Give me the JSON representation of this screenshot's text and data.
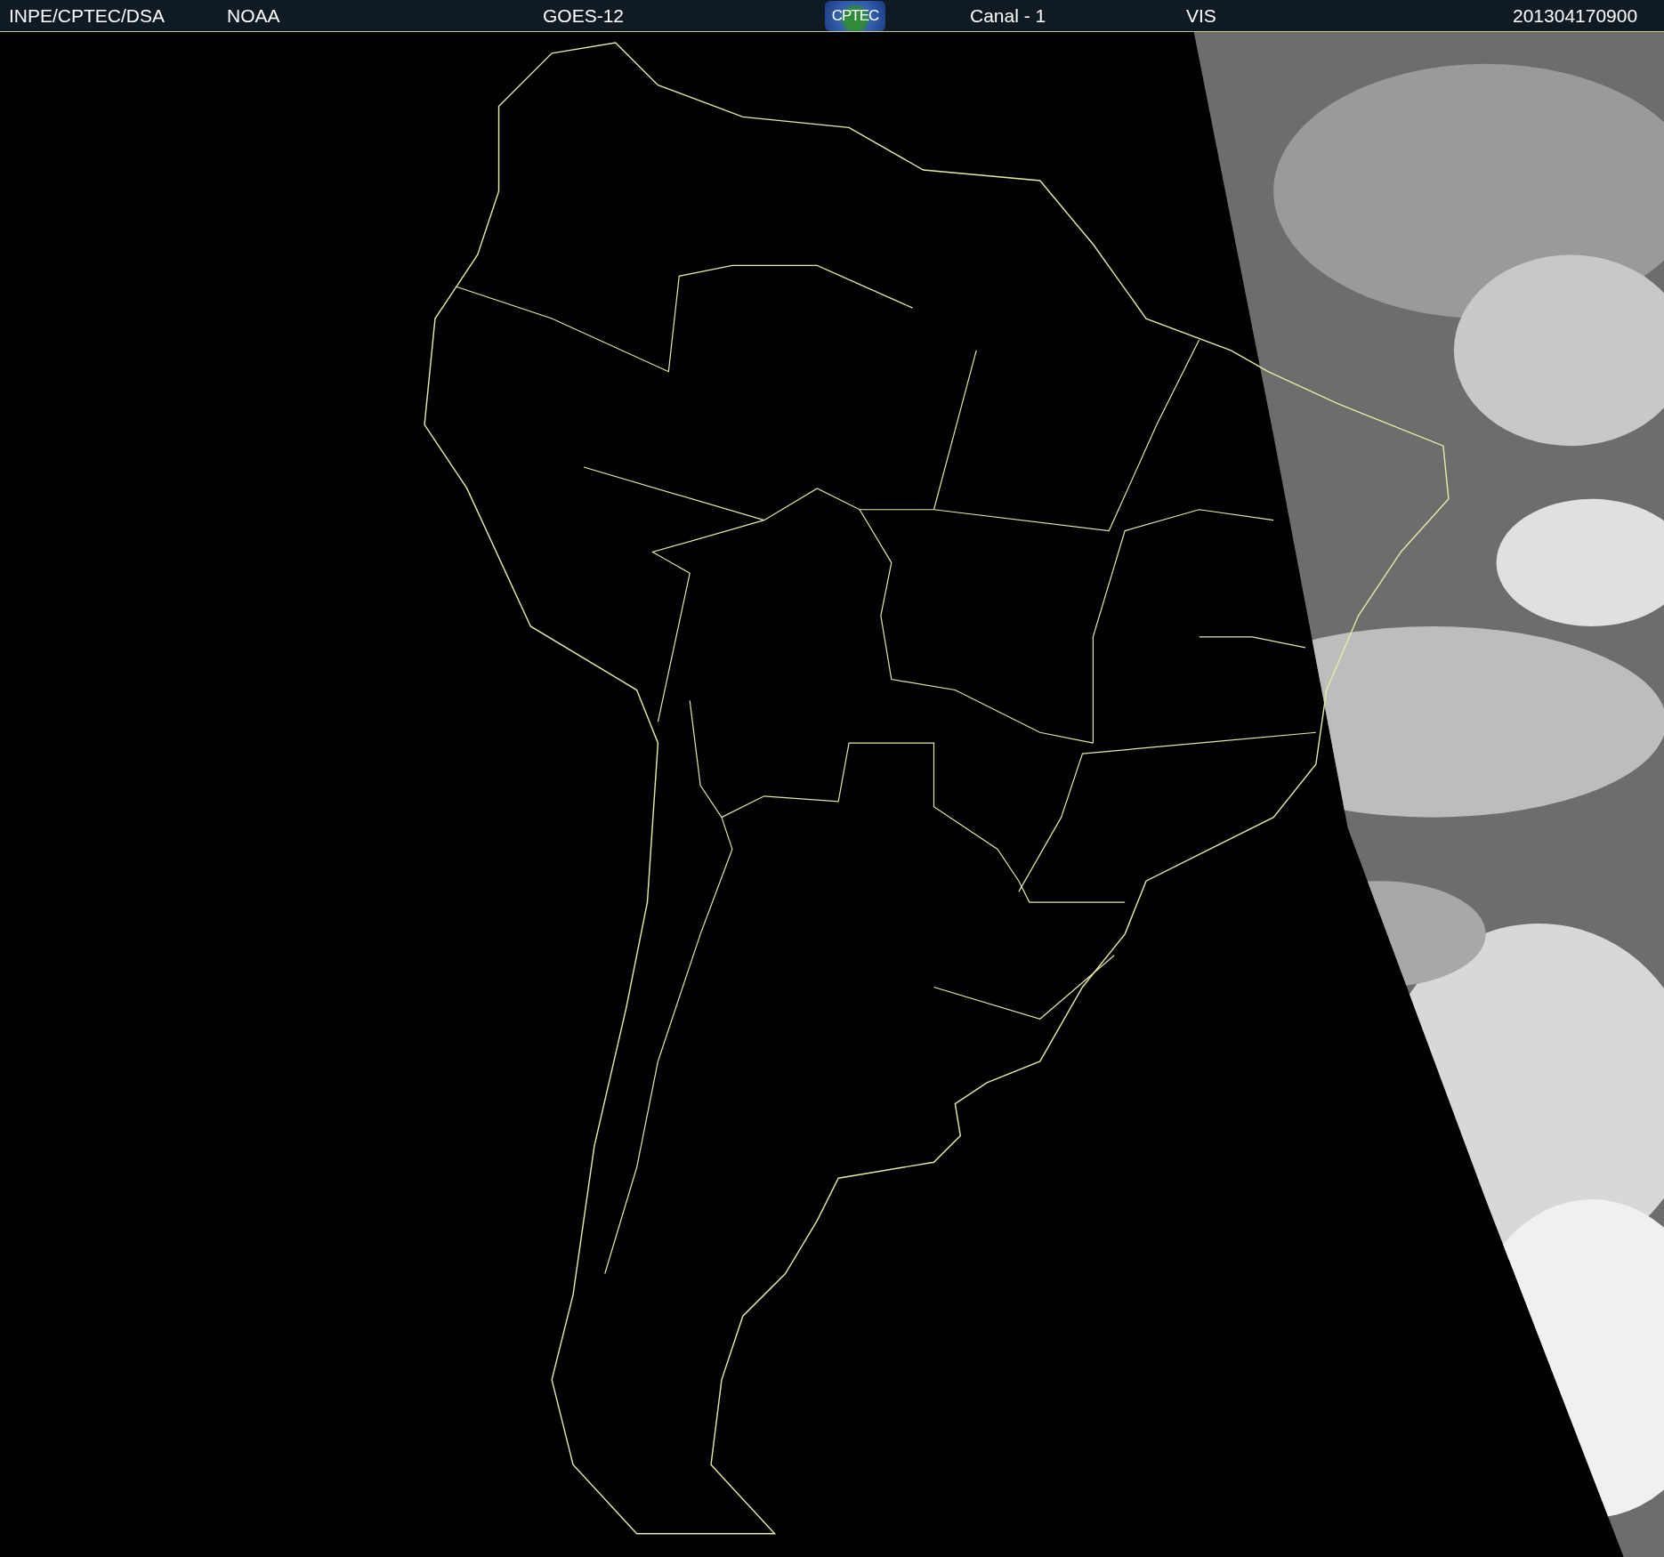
{
  "header": {
    "items": [
      {
        "kind": "text",
        "label": "INPE/CPTEC/DSA"
      },
      {
        "kind": "text",
        "label": "NOAA"
      },
      {
        "kind": "text",
        "label": "GOES-12"
      },
      {
        "kind": "logo",
        "label": "CPTEC"
      },
      {
        "kind": "text",
        "label": "Canal - 1"
      },
      {
        "kind": "text",
        "label": "VIS"
      },
      {
        "kind": "text",
        "label": "201304170900"
      }
    ]
  }
}
